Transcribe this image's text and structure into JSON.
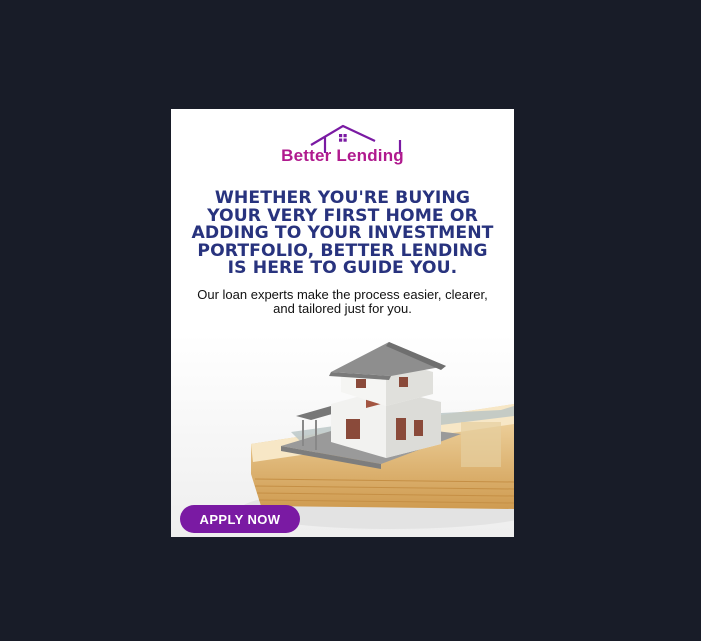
{
  "ad": {
    "brand": "Better Lending",
    "headline": "Whether you're buying your very first home or adding to your investment portfolio, Better Lending is here to guide you.",
    "subtext": "Our loan experts make the process easier, clearer, and tailored just for you.",
    "cta_label": "APPLY NOW",
    "colors": {
      "page_background": "#181c28",
      "brand": "#b01a8e",
      "headline": "#28337e",
      "cta": "#7a1aa3"
    },
    "icons": [
      "house-roof-logo-icon",
      "house-model-illustration",
      "banknote-stack-illustration"
    ]
  }
}
